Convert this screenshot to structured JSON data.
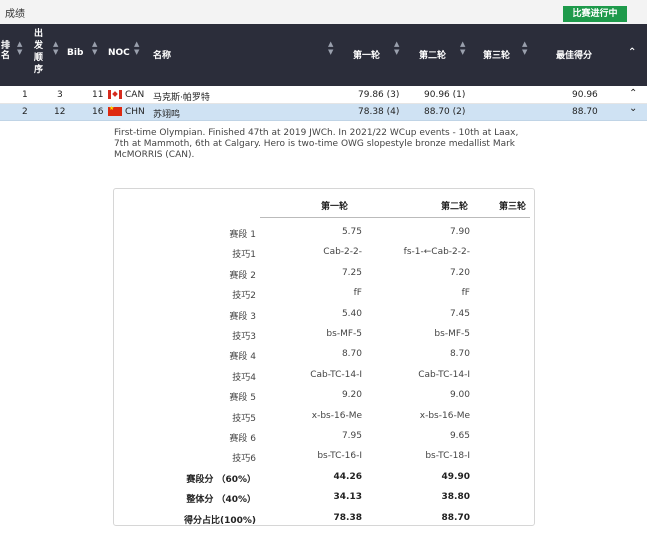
{
  "page": {
    "title": "成绩",
    "live_badge": "比赛进行中"
  },
  "table": {
    "headers": {
      "rank": [
        "排",
        "名"
      ],
      "start_order": [
        "出",
        "发",
        "顺",
        "序"
      ],
      "bib": "Bib",
      "noc": "NOC",
      "name": "名称",
      "run1": "第一轮",
      "run2": "第二轮",
      "run3": "第三轮",
      "best": "最佳得分"
    },
    "rows": [
      {
        "rank": "1",
        "order": "3",
        "bib": "11",
        "noc": "CAN",
        "name": "马克斯·帕罗特",
        "run1": "79.86 (3)",
        "run2": "90.96 (1)",
        "run3": "",
        "best": "90.96",
        "toggle": "⌃"
      },
      {
        "rank": "2",
        "order": "12",
        "bib": "16",
        "noc": "CHN",
        "name": "苏翊鸣",
        "run1": "78.38 (4)",
        "run2": "88.70 (2)",
        "run3": "",
        "best": "88.70",
        "toggle": "⌄"
      }
    ]
  },
  "detail": {
    "bio": "First-time Olympian. Finished 47th at 2019 JWCh. In 2021/22 WCup events - 10th at Laax, 7th at Mammoth, 6th at Calgary. Hero is two-time OWG slopestyle bronze medallist Mark McMORRIS (CAN).",
    "col_headers": [
      "第一轮",
      "第二轮",
      "第三轮"
    ],
    "rows": [
      {
        "label": "赛段 1",
        "run1": "5.75",
        "run2": "7.90",
        "bold": false
      },
      {
        "label": "技巧1",
        "run1": "Cab-2-2-",
        "run2": "fs-1-←Cab-2-2-",
        "bold": false
      },
      {
        "label": "赛段 2",
        "run1": "7.25",
        "run2": "7.20",
        "bold": false
      },
      {
        "label": "技巧2",
        "run1": "fF",
        "run2": "fF",
        "bold": false
      },
      {
        "label": "赛段 3",
        "run1": "5.40",
        "run2": "7.45",
        "bold": false
      },
      {
        "label": "技巧3",
        "run1": "bs-MF-5",
        "run2": "bs-MF-5",
        "bold": false
      },
      {
        "label": "赛段 4",
        "run1": "8.70",
        "run2": "8.70",
        "bold": false
      },
      {
        "label": "技巧4",
        "run1": "Cab-TC-14-I",
        "run2": "Cab-TC-14-I",
        "bold": false
      },
      {
        "label": "赛段 5",
        "run1": "9.20",
        "run2": "9.00",
        "bold": false
      },
      {
        "label": "技巧5",
        "run1": "x-bs-16-Me",
        "run2": "x-bs-16-Me",
        "bold": false
      },
      {
        "label": "赛段 6",
        "run1": "7.95",
        "run2": "9.65",
        "bold": false
      },
      {
        "label": "技巧6",
        "run1": "bs-TC-16-I",
        "run2": "bs-TC-18-I",
        "bold": false
      },
      {
        "label": "赛段分 （60%）",
        "run1": "44.26",
        "run2": "49.90",
        "bold": true
      },
      {
        "label": "整体分 （40%）",
        "run1": "34.13",
        "run2": "38.80",
        "bold": true
      },
      {
        "label": "得分占比(100%)",
        "run1": "78.38",
        "run2": "88.70",
        "bold": true
      }
    ]
  }
}
